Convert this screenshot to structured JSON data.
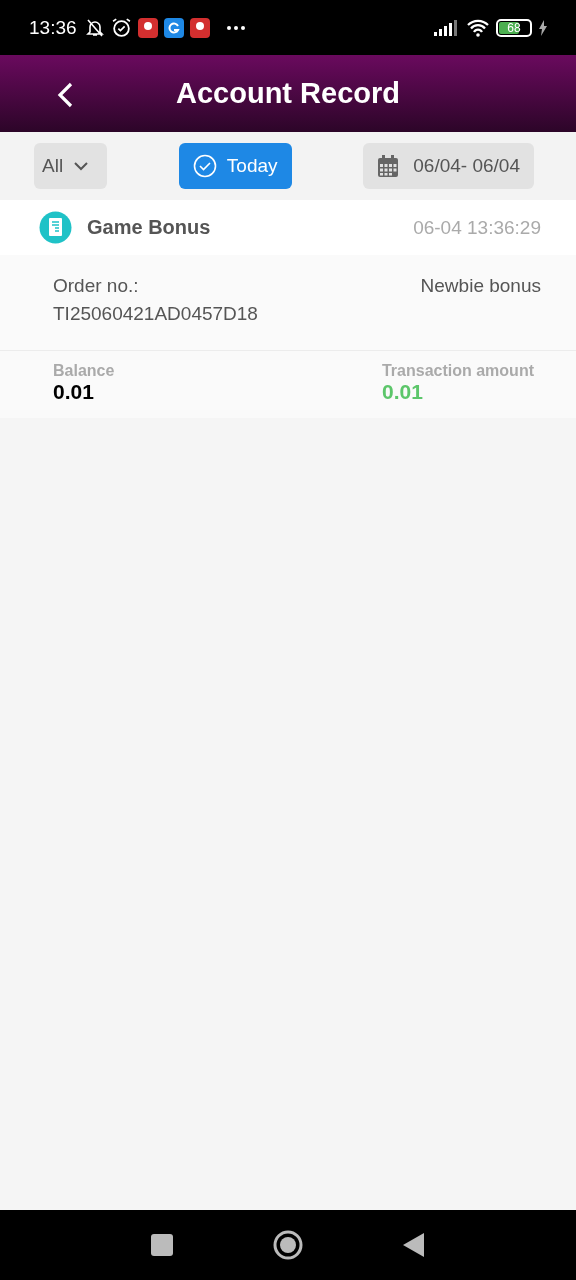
{
  "status_bar": {
    "time": "13:36",
    "battery": "68"
  },
  "header": {
    "title": "Account Record"
  },
  "filters": [
    {
      "kind": "dropdown",
      "label": "All",
      "selected": false
    },
    {
      "kind": "toggle",
      "label": "Today",
      "selected": true
    },
    {
      "kind": "date",
      "label": "06/04- 06/04",
      "selected": false
    }
  ],
  "records": [
    {
      "title": "Game Bonus",
      "time": "06-04 13:36:29",
      "order_label": "Order no.:",
      "order_no": "TI25060421AD0457D18",
      "type": "Newbie bonus",
      "balance_label": "Balance",
      "balance": "0.01",
      "amount_label": "Transaction amount",
      "amount": "0.01"
    }
  ]
}
